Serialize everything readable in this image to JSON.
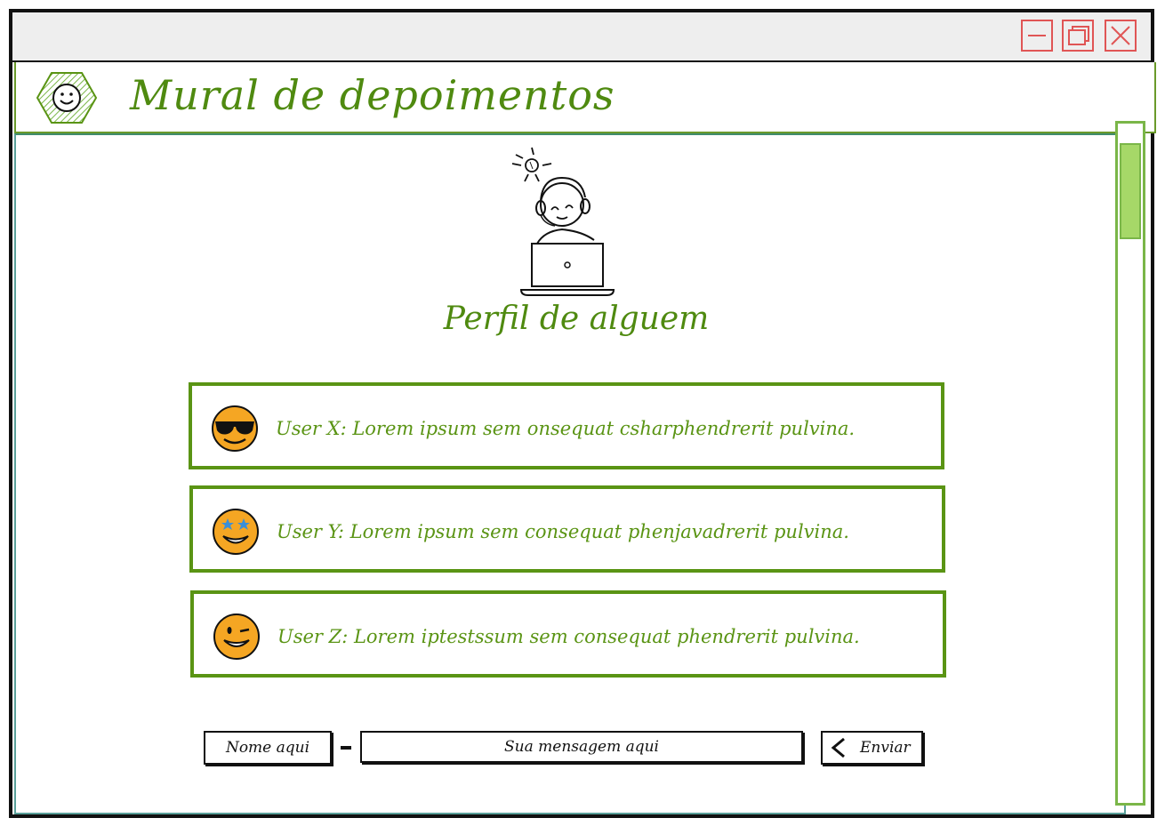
{
  "window": {
    "controls": {
      "minimize_icon": "minimize-icon",
      "maximize_icon": "maximize-icon",
      "close_icon": "close-icon"
    }
  },
  "header": {
    "logo_icon": "smiley-hexagon-icon",
    "title": "Mural de depoimentos"
  },
  "profile": {
    "illustration_icon": "person-laptop-icon",
    "title": "Perfil de alguem"
  },
  "testimonials": [
    {
      "emoji": "sunglasses-emoji-icon",
      "text": "User X: Lorem ipsum sem onsequat csharphendrerit pulvina."
    },
    {
      "emoji": "star-eyes-emoji-icon",
      "text": "User Y: Lorem ipsum sem consequat phenjavadrerit pulvina."
    },
    {
      "emoji": "wink-emoji-icon",
      "text": "User Z: Lorem iptestssum sem consequat phendrerit pulvina."
    }
  ],
  "form": {
    "name_placeholder": "Nome aqui",
    "message_placeholder": "Sua mensagem aqui",
    "send_label": "Enviar",
    "send_icon": "chevron-left-icon"
  },
  "colors": {
    "accent_green": "#4f8a10",
    "border_green": "#5a9414",
    "scroll_green": "#a6d868",
    "window_red": "#e05555",
    "emoji_orange": "#f5a623"
  }
}
